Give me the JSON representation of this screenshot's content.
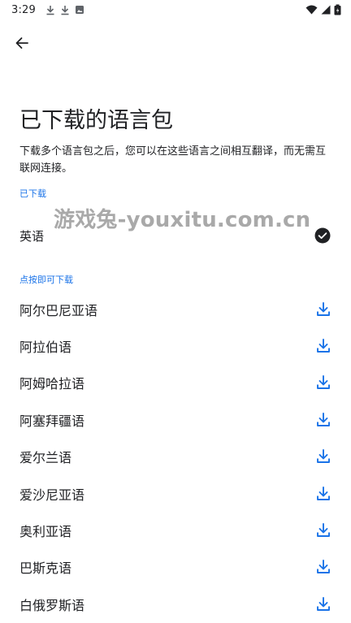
{
  "status_bar": {
    "time": "3:29",
    "left_icons": [
      "download-icon",
      "download-icon",
      "image-icon"
    ],
    "right_icons": [
      "wifi-icon",
      "signal-icon",
      "battery-icon"
    ]
  },
  "header": {
    "back_icon": "arrow-back-icon",
    "title": "已下载的语言包",
    "description": "下载多个语言包之后，您可以在这些语言之间相互翻译，而无需互联网连接。"
  },
  "downloaded": {
    "section_label": "已下载",
    "items": [
      {
        "label": "英语",
        "icon": "check-circle-icon"
      }
    ]
  },
  "available": {
    "section_label": "点按即可下载",
    "items": [
      {
        "label": "阿尔巴尼亚语",
        "icon": "download-icon"
      },
      {
        "label": "阿拉伯语",
        "icon": "download-icon"
      },
      {
        "label": "阿姆哈拉语",
        "icon": "download-icon"
      },
      {
        "label": "阿塞拜疆语",
        "icon": "download-icon"
      },
      {
        "label": "爱尔兰语",
        "icon": "download-icon"
      },
      {
        "label": "爱沙尼亚语",
        "icon": "download-icon"
      },
      {
        "label": "奥利亚语",
        "icon": "download-icon"
      },
      {
        "label": "巴斯克语",
        "icon": "download-icon"
      },
      {
        "label": "白俄罗斯语",
        "icon": "download-icon"
      }
    ]
  },
  "watermark": "游戏兔-youxitu.com.cn",
  "colors": {
    "accent": "#1a73e8",
    "text": "#202124",
    "icon_dark": "#202124"
  }
}
